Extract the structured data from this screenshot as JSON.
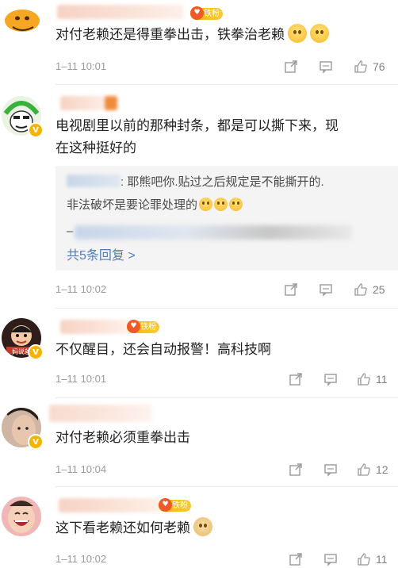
{
  "comments": [
    {
      "text": "对付老赖还是得重拳出击，铁拳治老赖",
      "time": "1–11 10:01",
      "likes": "76",
      "fan_badge": "铁粉",
      "emojis": [
        "smile-blush",
        "smile-blush"
      ]
    },
    {
      "text_line1": "电视剧里以前的那种封条，都是可以撕下来，现",
      "text_line2": "在这种挺好的",
      "time": "1–11 10:02",
      "likes": "25",
      "reply": {
        "line1": ": 耶熊吧你.贴过之后规定是不能撕开的.",
        "line2": "非法破坏是要论罪处理的",
        "dash": "–",
        "more": "共5条回复 >"
      }
    },
    {
      "text": "不仅醒目，还会自动报警！高科技啊",
      "time": "1–11 10:01",
      "likes": "11",
      "fan_badge": "铁粉",
      "avatar_caption": "妈说爸"
    },
    {
      "text": "对付老赖必须重拳出击",
      "time": "1–11 10:04",
      "likes": "12"
    },
    {
      "text": "这下看老赖还如何老赖",
      "time": "1–11 10:02",
      "likes": "11",
      "fan_badge": "铁粉"
    }
  ],
  "colors": {
    "accent_link": "#4f7fbf",
    "badge_gold": "#f7b500",
    "verified": "#f6b400"
  }
}
